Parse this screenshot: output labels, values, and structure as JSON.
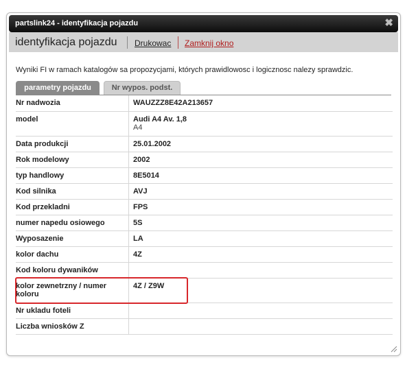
{
  "window": {
    "title": "partslink24 - identyfikacja pojazdu",
    "close_glyph": "✖"
  },
  "header": {
    "title": "identyfikacja pojazdu",
    "print_label": "Drukowac",
    "close_window_label": "Zamknij okno"
  },
  "info_text": "Wyniki FI w ramach katalogów sa propozycjami, których prawidlowosc i logicznosc nalezy sprawdzic.",
  "tabs": [
    {
      "label": "parametry pojazdu",
      "active": true
    },
    {
      "label": "Nr wypos. podst.",
      "active": false
    }
  ],
  "rows": [
    {
      "key": "Nr nadwozia",
      "value": "WAUZZZ8E42A213657",
      "sub": ""
    },
    {
      "key": "model",
      "value": "Audi A4 Av. 1,8",
      "sub": "A4"
    },
    {
      "key": "Data produkcji",
      "value": "25.01.2002",
      "sub": ""
    },
    {
      "key": "Rok modelowy",
      "value": "2002",
      "sub": ""
    },
    {
      "key": "typ handlowy",
      "value": "8E5014",
      "sub": ""
    },
    {
      "key": "Kod silnika",
      "value": "AVJ",
      "sub": ""
    },
    {
      "key": "Kod przekladni",
      "value": "FPS",
      "sub": ""
    },
    {
      "key": "numer napedu osiowego",
      "value": "5S",
      "sub": ""
    },
    {
      "key": "Wyposazenie",
      "value": "LA",
      "sub": ""
    },
    {
      "key": "kolor dachu",
      "value": "4Z",
      "sub": ""
    },
    {
      "key": "Kod koloru dywaników",
      "value": "",
      "sub": ""
    },
    {
      "key": "kolor zewnetrzny / numer koloru",
      "value": "4Z / Z9W",
      "sub": ""
    },
    {
      "key": "Nr ukladu foteli",
      "value": "",
      "sub": ""
    },
    {
      "key": "Liczba wniosków Z",
      "value": "",
      "sub": ""
    }
  ],
  "colors": {
    "highlight": "#d7262a",
    "close_link": "#b01c1c",
    "tab_active": "#8a8a8a"
  }
}
